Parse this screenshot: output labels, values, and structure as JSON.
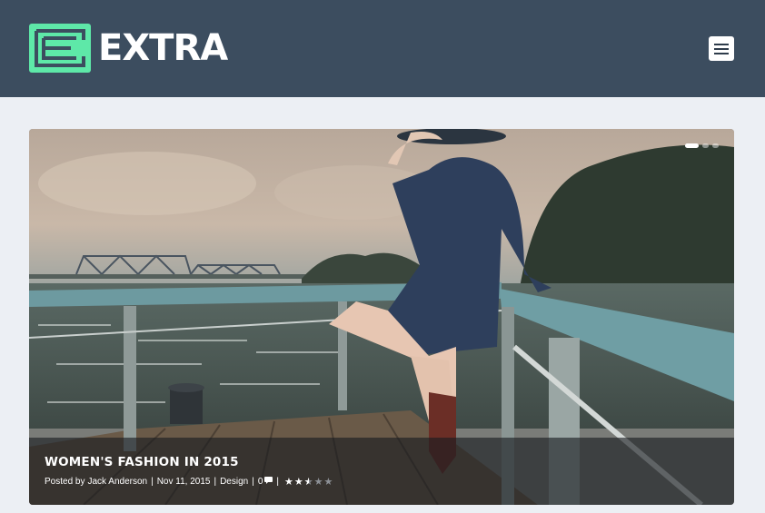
{
  "header": {
    "logo_text": "EXTRA",
    "logo_icon": "extra-e-logo-icon",
    "menu_icon": "hamburger-menu-icon",
    "background": "#3c4d5f",
    "accent": "#5ee8a8"
  },
  "slider": {
    "dots": [
      {
        "active": true
      },
      {
        "active": false
      },
      {
        "active": false
      }
    ],
    "post": {
      "title": "WOMEN'S FASHION IN 2015",
      "posted_by_label": "Posted by",
      "author": "Jack Anderson",
      "date": "Nov 11, 2015",
      "category": "Design",
      "comments": "0",
      "comment_icon": "comment-bubble-icon",
      "separator": "|",
      "rating": 2.5,
      "rating_max": 5
    }
  }
}
